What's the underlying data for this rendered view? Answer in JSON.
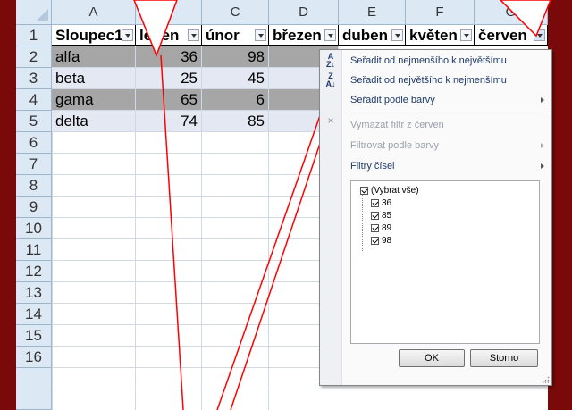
{
  "columns": [
    "A",
    "B",
    "C",
    "D",
    "E",
    "F",
    "G"
  ],
  "rows": [
    "1",
    "2",
    "3",
    "4",
    "5",
    "6",
    "7",
    "8",
    "9",
    "10",
    "11",
    "12",
    "13",
    "14",
    "15",
    "16"
  ],
  "table": {
    "headers": [
      "Sloupec1",
      "leden",
      "únor",
      "březen",
      "duben",
      "květen",
      "červen"
    ],
    "data": [
      [
        "alfa",
        "36",
        "98"
      ],
      [
        "beta",
        "25",
        "45"
      ],
      [
        "gama",
        "65",
        "6"
      ],
      [
        "delta",
        "74",
        "85"
      ]
    ]
  },
  "filter_menu": {
    "sort_asc": "Seřadit od nejmenšího k největšímu",
    "sort_desc": "Seřadit od největšího k nejmenšímu",
    "sort_color": "Seřadit podle barvy",
    "clear_filter": "Vymazat filtr z červen",
    "filter_color": "Filtrovat podle barvy",
    "number_filters": "Filtry čísel",
    "select_all": "(Vybrat vše)",
    "values": [
      "36",
      "85",
      "89",
      "98"
    ],
    "ok": "OK",
    "cancel": "Storno"
  },
  "colors": {
    "background": "#7a0a0a",
    "band_dark": "#a6a6a6",
    "band_light": "#e4e8f2",
    "header_bg": "#dde8f5",
    "callout_line": "#ff0000"
  }
}
